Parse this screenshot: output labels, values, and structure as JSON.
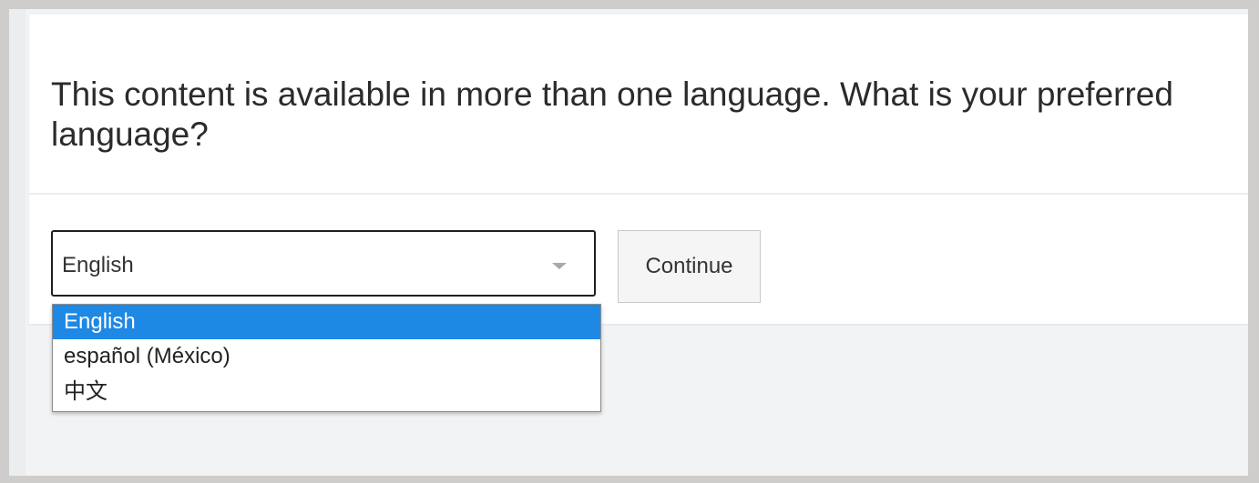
{
  "prompt": {
    "title": "This content is available in more than one language. What is your preferred language?"
  },
  "language_select": {
    "selected_value": "English",
    "options": [
      "English",
      "español (México)",
      "中文"
    ]
  },
  "continue_button": {
    "label": "Continue"
  },
  "colors": {
    "highlight": "#1e88e5",
    "background": "#f2f3f5",
    "card": "#ffffff",
    "outer_border": "#cfcdcb"
  },
  "icons": {
    "select_arrow": "chevron-down-icon"
  }
}
